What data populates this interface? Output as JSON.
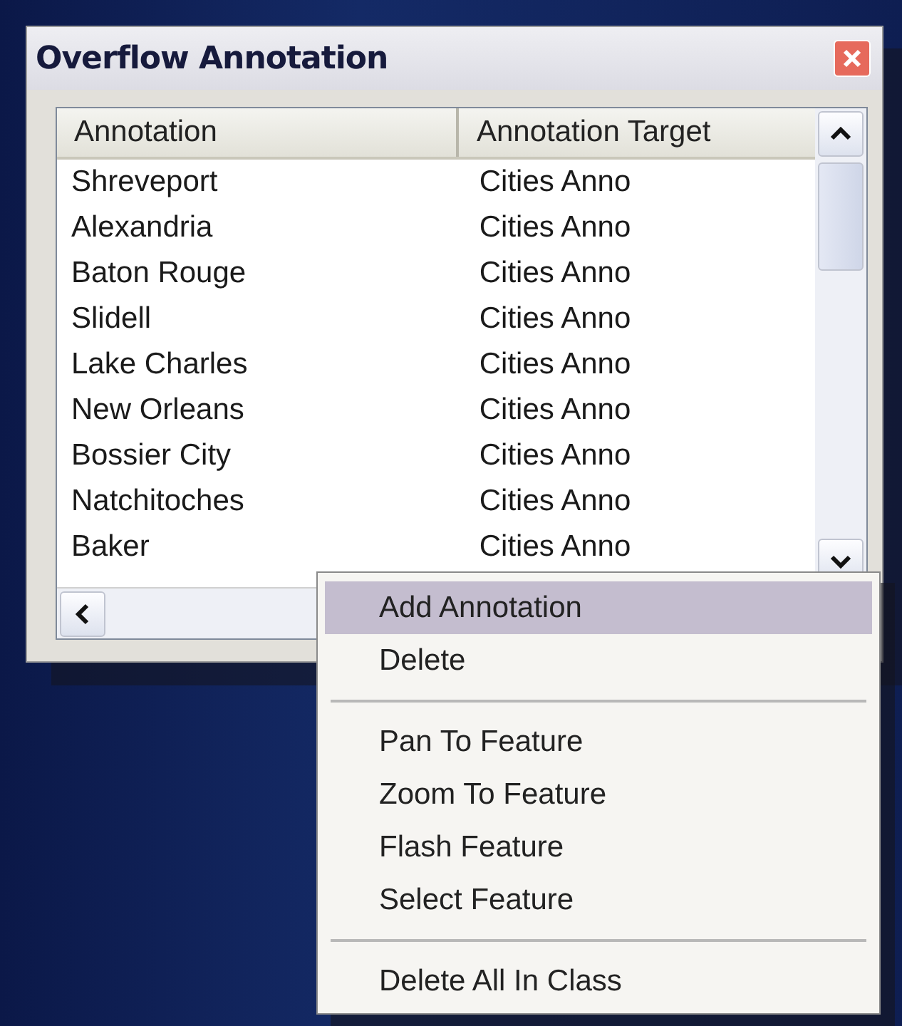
{
  "window": {
    "title": "Overflow Annotation"
  },
  "table": {
    "columns": [
      "Annotation",
      "Annotation Target"
    ],
    "rows": [
      {
        "annotation": "Shreveport",
        "target": "Cities Anno"
      },
      {
        "annotation": "Alexandria",
        "target": "Cities Anno"
      },
      {
        "annotation": "Baton Rouge",
        "target": "Cities Anno"
      },
      {
        "annotation": "Slidell",
        "target": "Cities Anno"
      },
      {
        "annotation": "Lake Charles",
        "target": "Cities Anno"
      },
      {
        "annotation": "New Orleans",
        "target": "Cities Anno"
      },
      {
        "annotation": "Bossier City",
        "target": "Cities Anno"
      },
      {
        "annotation": "Natchitoches",
        "target": "Cities Anno"
      },
      {
        "annotation": "Baker",
        "target": "Cities Anno"
      }
    ]
  },
  "context_menu": {
    "items": [
      {
        "kind": "item",
        "label": "Add Annotation",
        "selected": true
      },
      {
        "kind": "item",
        "label": "Delete",
        "selected": false
      },
      {
        "kind": "separator"
      },
      {
        "kind": "item",
        "label": "Pan To Feature",
        "selected": false
      },
      {
        "kind": "item",
        "label": "Zoom To Feature",
        "selected": false
      },
      {
        "kind": "item",
        "label": "Flash Feature",
        "selected": false
      },
      {
        "kind": "item",
        "label": "Select Feature",
        "selected": false
      },
      {
        "kind": "separator"
      },
      {
        "kind": "item",
        "label": "Delete All In Class",
        "selected": false
      }
    ]
  }
}
